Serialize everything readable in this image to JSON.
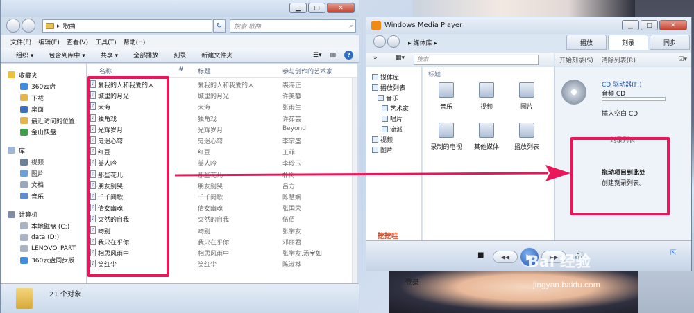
{
  "explorer": {
    "breadcrumb": "歌曲",
    "search_placeholder": "搜索 歌曲",
    "menu": [
      "文件(F)",
      "编辑(E)",
      "查看(V)",
      "工具(T)",
      "帮助(H)"
    ],
    "toolbar": [
      "组织 ▾",
      "包含到库中 ▾",
      "共享 ▾",
      "全部播放",
      "刻录",
      "新建文件夹"
    ],
    "nav": [
      {
        "label": "收藏夹",
        "icon": "star-icon",
        "header": true
      },
      {
        "label": "360云盘",
        "icon": "cloud-icon"
      },
      {
        "label": "下载",
        "icon": "download-folder-icon"
      },
      {
        "label": "桌面",
        "icon": "desktop-icon"
      },
      {
        "label": "最近访问的位置",
        "icon": "recent-places-icon"
      },
      {
        "label": "金山快盘",
        "icon": "kuaipan-icon"
      },
      {
        "label": "库",
        "icon": "libraries-icon",
        "header": true
      },
      {
        "label": "视频",
        "icon": "video-library-icon"
      },
      {
        "label": "图片",
        "icon": "picture-library-icon"
      },
      {
        "label": "文档",
        "icon": "document-library-icon"
      },
      {
        "label": "音乐",
        "icon": "music-library-icon"
      },
      {
        "label": "计算机",
        "icon": "computer-icon",
        "header": true
      },
      {
        "label": "本地磁盘 (C:)",
        "icon": "drive-icon"
      },
      {
        "label": "data (D:)",
        "icon": "drive-icon"
      },
      {
        "label": "LENOVO_PART",
        "icon": "drive-icon"
      },
      {
        "label": "360云盘同步版",
        "icon": "cloud-sync-icon"
      }
    ],
    "columns": {
      "name": "名称",
      "number": "#",
      "title": "标题",
      "artist": "参与创作的艺术家"
    },
    "files": [
      {
        "name": "爱我的人和我爱的人",
        "title": "爱我的人和我爱的人",
        "artist": "裘海正"
      },
      {
        "name": "城里的月光",
        "title": "城里的月光",
        "artist": "许美静"
      },
      {
        "name": "大海",
        "title": "大海",
        "artist": "张雨生"
      },
      {
        "name": "独角戏",
        "title": "独角戏",
        "artist": "许茹芸"
      },
      {
        "name": "光辉岁月",
        "title": "光辉岁月",
        "artist": "Beyond"
      },
      {
        "name": "鬼迷心窍",
        "title": "鬼迷心窍",
        "artist": "李宗盛"
      },
      {
        "name": "红豆",
        "title": "红豆",
        "artist": "王菲"
      },
      {
        "name": "美人吟",
        "title": "美人吟",
        "artist": "李玲玉"
      },
      {
        "name": "那些花儿",
        "title": "那些花儿",
        "artist": "朴树"
      },
      {
        "name": "朋友别哭",
        "title": "朋友别哭",
        "artist": "吕方"
      },
      {
        "name": "千千阙歌",
        "title": "千千阙歌",
        "artist": "陈慧娴"
      },
      {
        "name": "倩女幽魂",
        "title": "倩女幽魂",
        "artist": "张国荣"
      },
      {
        "name": "突然的自我",
        "title": "突然的自我",
        "artist": "伍佰"
      },
      {
        "name": "吻别",
        "title": "吻别",
        "artist": "张学友"
      },
      {
        "name": "我只在乎你",
        "title": "我只在乎你",
        "artist": "邓丽君"
      },
      {
        "name": "相思风雨中",
        "title": "相思风雨中",
        "artist": "张学友,汤宝如"
      },
      {
        "name": "笑红尘",
        "title": "笑红尘",
        "artist": "陈淑桦"
      }
    ],
    "status": "21 个对象"
  },
  "wmp": {
    "title": "Windows Media Player",
    "breadcrumb": "媒体库",
    "tabs": [
      "播放",
      "刻录",
      "同步"
    ],
    "active_tab": "刻录",
    "search_placeholder": "搜索",
    "burn_toolbar": [
      "开始刻录(S)",
      "清除列表(R)"
    ],
    "lib_nav": [
      "媒体库",
      "播放列表",
      "音乐",
      "艺术家",
      "唱片",
      "流派",
      "视频",
      "图片"
    ],
    "category_header": "标题",
    "categories": [
      {
        "label": "音乐",
        "icon": "music-note-icon"
      },
      {
        "label": "视频",
        "icon": "film-icon"
      },
      {
        "label": "图片",
        "icon": "picture-icon"
      },
      {
        "label": "录制的电视",
        "icon": "tv-icon"
      },
      {
        "label": "其他媒体",
        "icon": "other-media-icon"
      },
      {
        "label": "播放列表",
        "icon": "playlist-icon"
      }
    ],
    "wawa": "挖挖哇",
    "login": "登录",
    "drive_name": "CD 驱动器(F:)",
    "drive_type": "音频 CD",
    "drive_hint": "插入空白 CD",
    "drop_title": "拖动项目到此处",
    "drop_sub": "创建刻录列表。",
    "list_header": "刻录列表"
  },
  "watermark": {
    "text": "Bai 经验",
    "url": "jingyan.baidu.com"
  },
  "colors": {
    "highlight": "#e9175a",
    "accent": "#2f6fc2"
  }
}
